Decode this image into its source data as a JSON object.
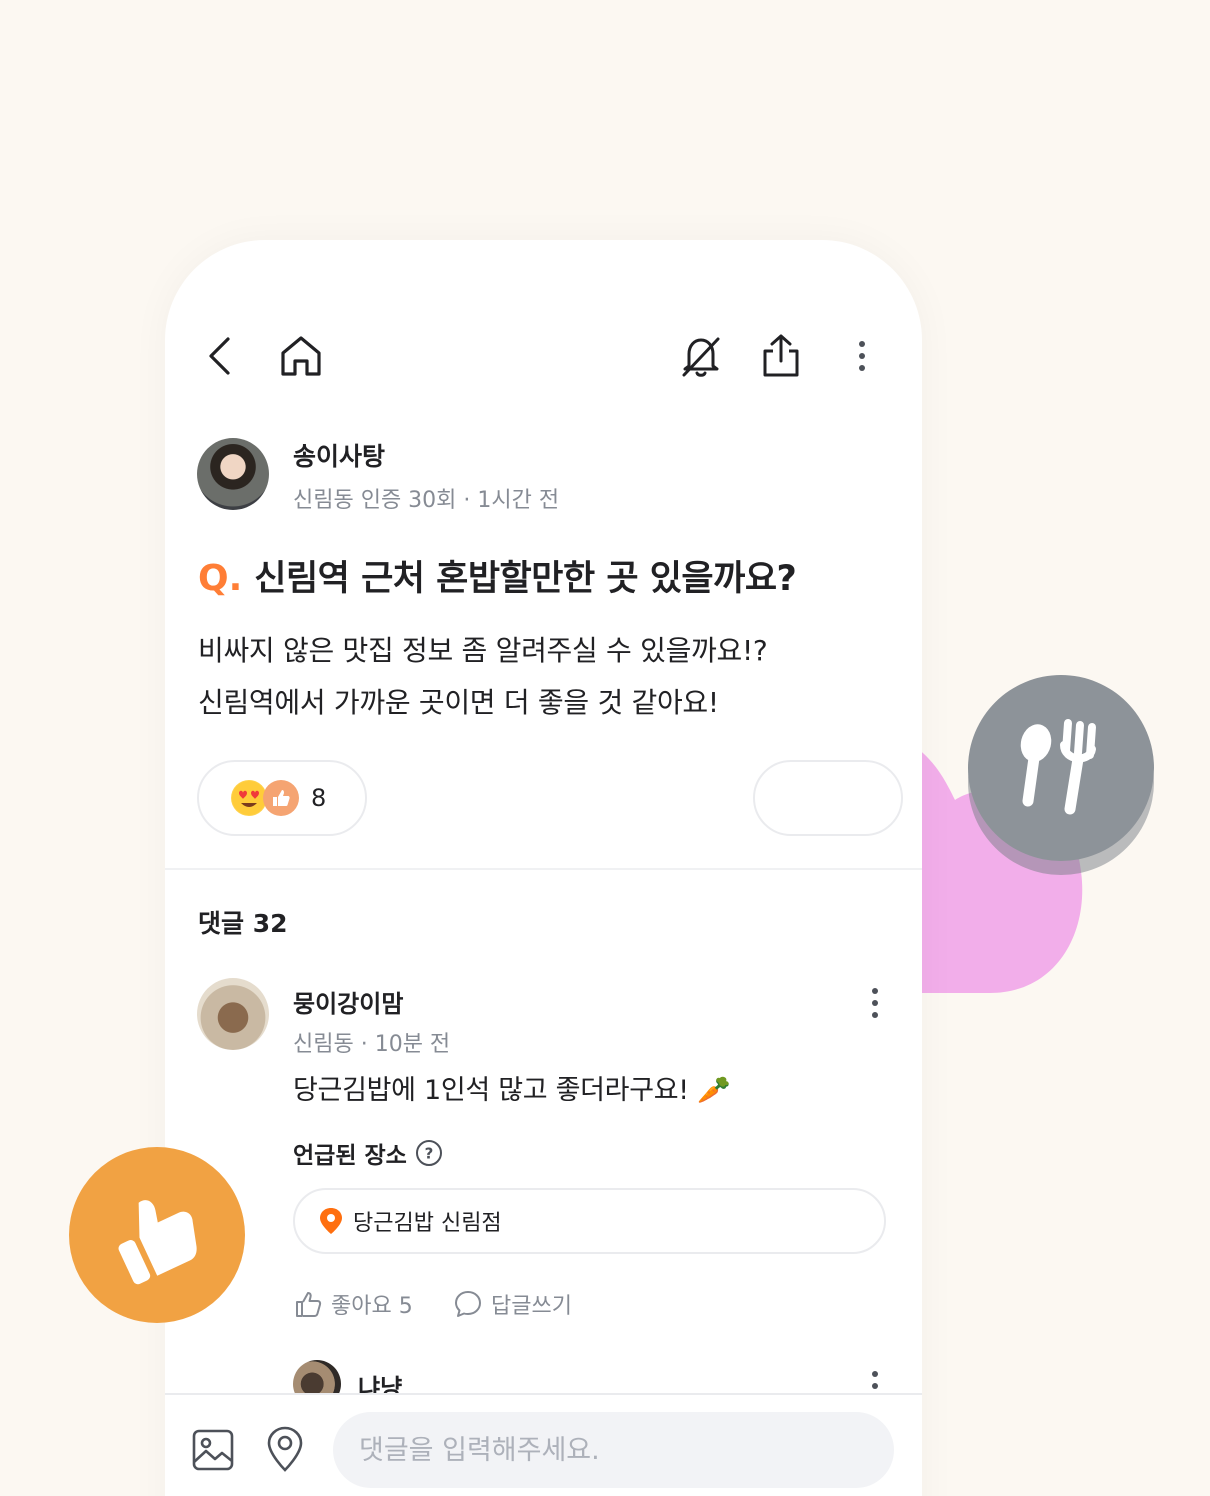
{
  "post": {
    "author_name": "송이사탕",
    "author_meta": "신림동 인증 30회 · 1시간 전",
    "q_mark": "Q.",
    "title": "신림역 근처 혼밥할만한 곳 있을까요?",
    "body_line1": "비싸지 않은 맛집 정보 좀 알려주실 수 있을까요!?",
    "body_line2": "신림역에서 가까운 곳이면 더 좋을 것 같아요!",
    "reaction_count": "8",
    "reaction_icons": [
      "heart-eyes-emoji",
      "thumbs-up-emoji"
    ]
  },
  "comments_header": "댓글 32",
  "comments": [
    {
      "author_name": "뭉이강이맘",
      "meta": "신림동 · 10분 전",
      "text": "당근김밥에 1인석 많고 좋더라구요! 🥕",
      "mentioned_label": "언급된 장소",
      "place_name": "당근김밥 신림점",
      "like_label": "좋아요 5",
      "reply_label": "답글쓰기"
    },
    {
      "author_name": "냐냥"
    }
  ],
  "input": {
    "placeholder": "댓글을 입력해주세요."
  },
  "colors": {
    "accent": "#ff7e36",
    "heart": "#f2aeea",
    "spoon_badge": "#8d9399",
    "thumb_badge": "#f1a243",
    "background": "#fcf8f2"
  }
}
